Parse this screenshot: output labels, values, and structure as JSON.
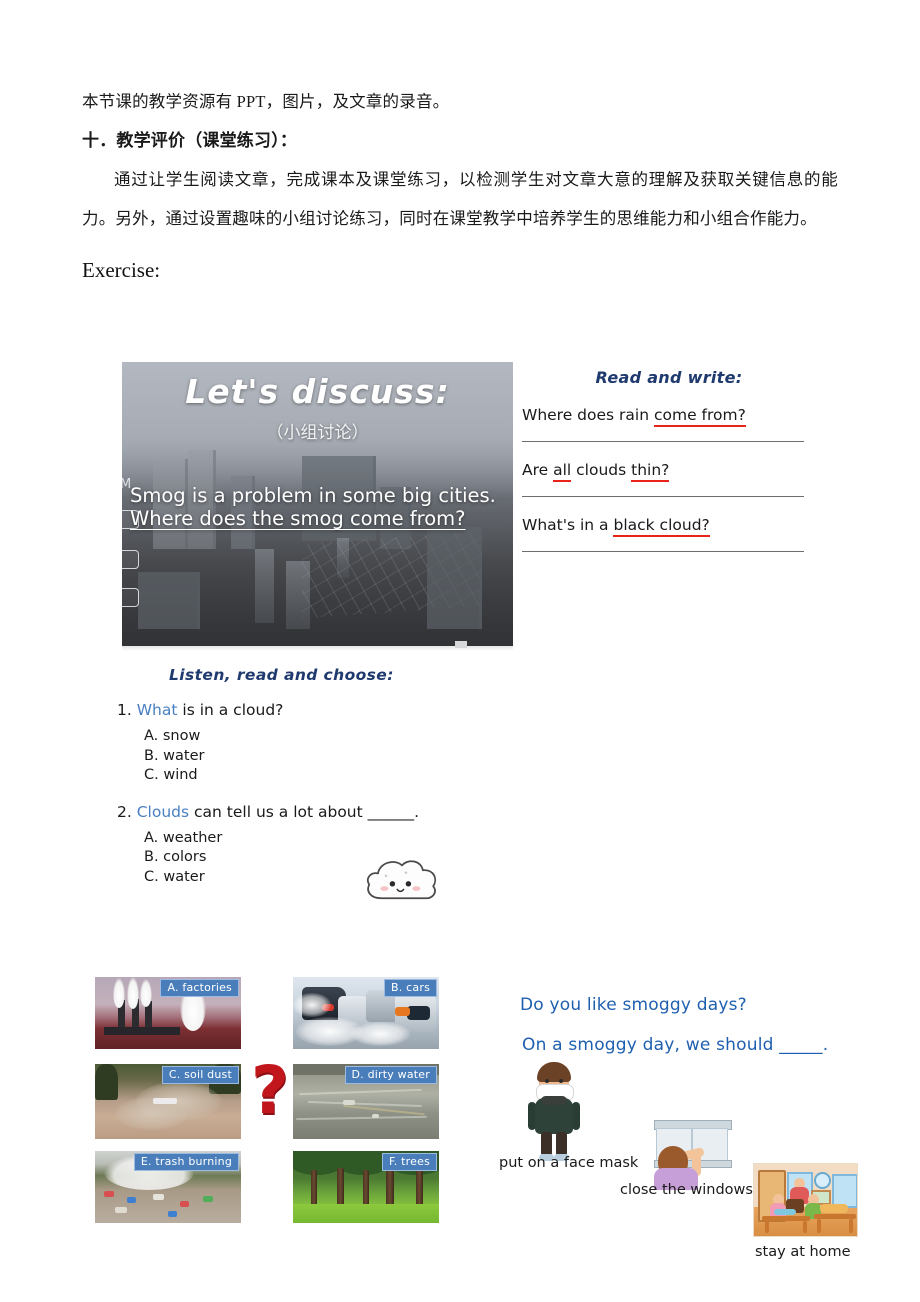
{
  "document": {
    "line1": "本节课的教学资源有 PPT，图片，及文章的录音。",
    "heading": "十．教学评价（课堂练习）：",
    "paragraph": "通过让学生阅读文章，完成课本及课堂练习，以检测学生对文章大意的理解及获取关键信息的能力。另外，通过设置趣味的小组讨论练习，同时在课堂教学中培养学生的思维能力和小组合作能力。",
    "exercise_label": "Exercise:"
  },
  "slide": {
    "title": "Let's discuss:",
    "subtitle": "（小组讨论）",
    "question_line1": "Smog is a problem in some big cities.",
    "question_line2": "Where does the smog come from?",
    "ghost_marker": "M"
  },
  "read_and_write": {
    "title": "Read and write:",
    "questions": [
      {
        "before": "Where does rain ",
        "underlined": "come from?",
        "after": ""
      },
      {
        "before": "Are ",
        "underlined": "all",
        "mid": " clouds ",
        "underlined2": "thin?",
        "after": ""
      },
      {
        "before": "What's in a ",
        "underlined": "black cloud?",
        "after": ""
      }
    ],
    "q1_plain": "Where does rain ",
    "q1_red": "come from?",
    "q2_a": "Are ",
    "q2_red1": "all",
    "q2_b": " clouds ",
    "q2_red2": "thin?",
    "q3_a": "What's in a ",
    "q3_red": "black cloud?"
  },
  "listen_read_choose": {
    "title": "Listen, read and choose:",
    "questions": [
      {
        "number": "1.",
        "keyword": "What",
        "rest": " is in a cloud?",
        "options": [
          "A. snow",
          "B. water",
          "C. wind"
        ]
      },
      {
        "number": "2.",
        "keyword": "Clouds",
        "rest": " can tell us a lot about ______.",
        "options": [
          "A. weather",
          "B. colors",
          "C. water"
        ]
      }
    ],
    "cloud_icon": "cloud-face-icon"
  },
  "photo_grid": {
    "center_icon": "question-mark-icon",
    "items": [
      {
        "label": "A. factories",
        "art": "factories"
      },
      {
        "label": "B. cars",
        "art": "cars"
      },
      {
        "label": "C. soil dust",
        "art": "soil-dust"
      },
      {
        "label": "D. dirty water",
        "art": "dirty-water"
      },
      {
        "label": "E. trash burning",
        "art": "trash-burning"
      },
      {
        "label": "F. trees",
        "art": "trees"
      }
    ]
  },
  "advice": {
    "line1": "Do you like smoggy days?",
    "line2": "On a smoggy day, we should _____.",
    "captions": [
      {
        "text": "put on a face mask",
        "icon": "person-with-mask-icon"
      },
      {
        "text": "close the windows",
        "icon": "boy-closing-window-icon"
      },
      {
        "text": "stay at home",
        "icon": "family-at-home-icon"
      }
    ]
  },
  "colors": {
    "heading_blue": "#1f3a6e",
    "keyword_blue": "#4a7fc1",
    "advice_blue": "#1f5fb0",
    "red_underline": "#e8231a",
    "label_blue": "#4a7ebb",
    "qmark_red": "#c0161c"
  }
}
